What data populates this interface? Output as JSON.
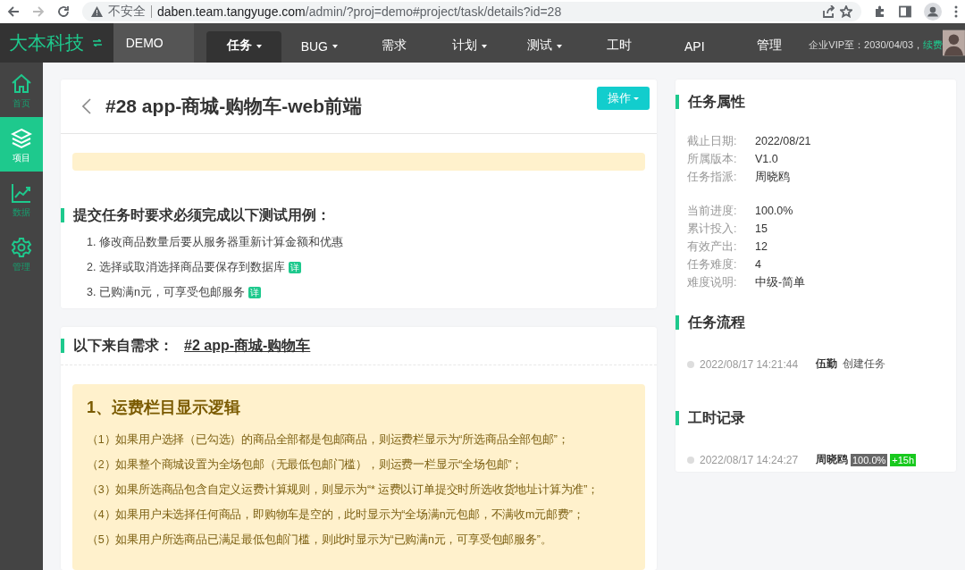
{
  "browser": {
    "security": "不安全",
    "url_host": "daben.team.tangyuge.com",
    "url_path": "/admin/?proj=demo#project/task/details?id=28"
  },
  "nav": {
    "brand": "大本科技",
    "project": "DEMO",
    "tabs": [
      {
        "label": "任务",
        "selected": true,
        "dropdown": true
      },
      {
        "label": "BUG",
        "selected": false,
        "dropdown": true
      },
      {
        "label": "需求",
        "selected": false,
        "dropdown": false
      },
      {
        "label": "计划",
        "selected": false,
        "dropdown": true
      },
      {
        "label": "测试",
        "selected": false,
        "dropdown": true
      },
      {
        "label": "工时",
        "selected": false,
        "dropdown": false
      },
      {
        "label": "API",
        "selected": false,
        "dropdown": false
      },
      {
        "label": "管理",
        "selected": false,
        "dropdown": false
      }
    ],
    "vip": "企业VIP至：2030/04/03，",
    "renew": "续费"
  },
  "sidebar": {
    "items": [
      {
        "label": "首页",
        "kind": "home",
        "selected": false
      },
      {
        "label": "项目",
        "kind": "layers",
        "selected": true
      },
      {
        "label": "数据",
        "kind": "chart",
        "selected": false
      },
      {
        "label": "管理",
        "kind": "gear",
        "selected": false
      }
    ]
  },
  "task": {
    "title": "#28 app-商城-购物车-web前端",
    "action": "操作",
    "tests_heading": "提交任务时要求必须完成以下测试用例：",
    "tests": [
      {
        "text": "1. 修改商品数量后要从服务器重新计算金额和优惠"
      },
      {
        "text": "2. 选择或取消选择商品要保存到数据库",
        "detail": "详"
      },
      {
        "text": "3. 已购满n元，可享受包邮服务",
        "detail": "详"
      }
    ]
  },
  "requirement": {
    "label": "以下来自需求：",
    "link": "#2 app-商城-购物车",
    "section_title": "1、运费栏目显示逻辑",
    "items": [
      "（1）如果用户选择（已勾选）的商品全部都是包邮商品，则运费栏显示为“所选商品全部包邮”；",
      "（2）如果整个商城设置为全场包邮（无最低包邮门槛），则运费一栏显示“全场包邮”；",
      "（3）如果所选商品包含自定义运费计算规则，则显示为“* 运费以订单提交时所选收货地址计算为准”；",
      "（4）如果用户未选择任何商品，即购物车是空的，此时显示为“全场满n元包邮，不满收m元邮费”；",
      "（5）如果用户所选商品已满足最低包邮门槛，则此时显示为“已购满n元，可享受包邮服务”。"
    ]
  },
  "properties": {
    "title": "任务属性",
    "groups": [
      [
        {
          "label": "截止日期:",
          "value": "2022/08/21"
        },
        {
          "label": "所属版本:",
          "value": "V1.0"
        },
        {
          "label": "任务指派:",
          "value": "周晓鸥"
        }
      ],
      [
        {
          "label": "当前进度:",
          "value": "100.0%"
        },
        {
          "label": "累计投入:",
          "value": "15"
        },
        {
          "label": "有效产出:",
          "value": "12"
        },
        {
          "label": "任务难度:",
          "value": "4"
        },
        {
          "label": "难度说明:",
          "value": "中级-简单"
        }
      ]
    ]
  },
  "flow": {
    "title": "任务流程",
    "entries": [
      {
        "time": "2022/08/17 14:21:44",
        "user": "伍勤",
        "action": "创建任务"
      }
    ]
  },
  "worklog": {
    "title": "工时记录",
    "entries": [
      {
        "time": "2022/08/17 14:24:27",
        "user": "周晓鸥",
        "progress": "100.0%",
        "hours": "+15h"
      }
    ]
  }
}
